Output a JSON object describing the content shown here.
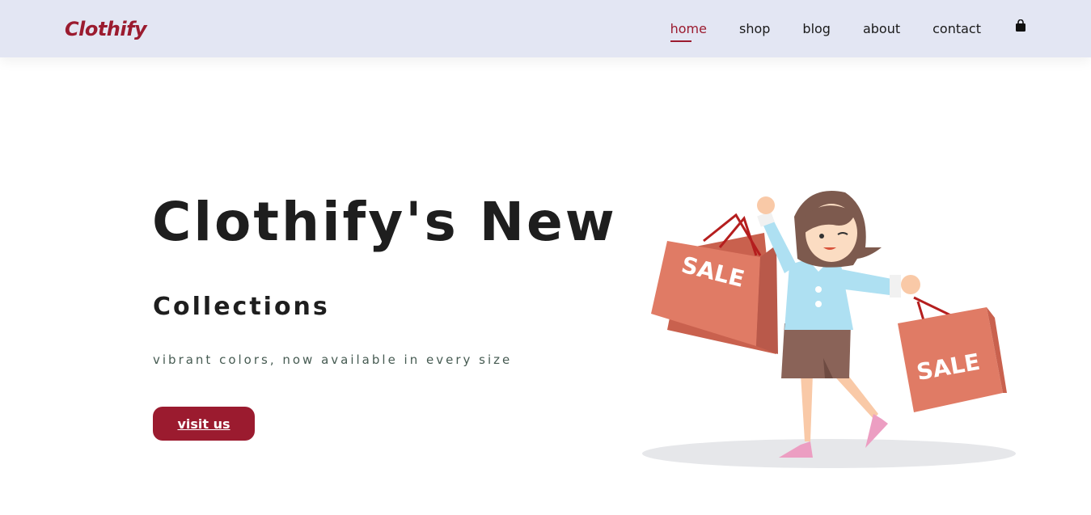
{
  "brand": {
    "name": "Clothify",
    "color": "#9b1b2f"
  },
  "nav": {
    "items": [
      {
        "label": "home",
        "active": true
      },
      {
        "label": "shop",
        "active": false
      },
      {
        "label": "blog",
        "active": false
      },
      {
        "label": "about",
        "active": false
      },
      {
        "label": "contact",
        "active": false
      }
    ],
    "cart_icon": "shopping-bag-icon"
  },
  "hero": {
    "title": "Clothify's New",
    "subtitle": "Collections",
    "description": "vibrant colors, now available in every size",
    "button_label": "visit us",
    "illustration": {
      "icon": "shopping-woman-illustration",
      "bag_text_left": "SALE",
      "bag_text_right": "SALE"
    }
  },
  "colors": {
    "navbar_bg": "#e3e6f3",
    "accent": "#9b1b2f",
    "text_dark": "#1e1e1e",
    "desc_text": "#465b52",
    "bag": "#e07b65"
  }
}
